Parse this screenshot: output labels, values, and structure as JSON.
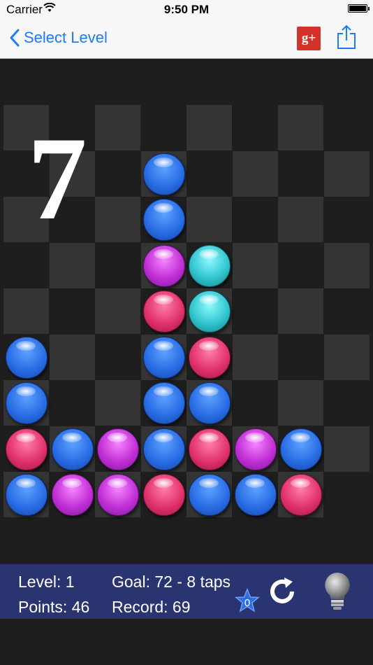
{
  "status": {
    "carrier": "Carrier",
    "time": "9:50 PM"
  },
  "nav": {
    "back_label": "Select Level",
    "gplus_label": "g+"
  },
  "countdown": "7",
  "hud": {
    "level": "Level: 1",
    "goal": "Goal: 72 - 8 taps",
    "points": "Points: 46",
    "record": "Record: 69",
    "stars": "0"
  },
  "colors": {
    "blue": "#2a6ee6",
    "pink": "#e2336d",
    "purple": "#c230d6",
    "cyan": "#32c6cf",
    "hud": "#2a3470",
    "accent": "#1b7cf5"
  },
  "board": {
    "cols": 8,
    "rows": 9,
    "grid": [
      [
        "",
        "",
        "",
        "",
        "",
        "",
        "",
        ""
      ],
      [
        "",
        "",
        "",
        "blue",
        "",
        "",
        "",
        ""
      ],
      [
        "",
        "",
        "",
        "blue",
        "",
        "",
        "",
        ""
      ],
      [
        "",
        "",
        "",
        "purple",
        "cyan",
        "",
        "",
        ""
      ],
      [
        "",
        "",
        "",
        "pink",
        "cyan",
        "",
        "",
        ""
      ],
      [
        "blue",
        "",
        "",
        "blue",
        "pink",
        "",
        "",
        ""
      ],
      [
        "blue",
        "",
        "",
        "blue",
        "blue",
        "",
        "",
        ""
      ],
      [
        "pink",
        "blue",
        "purple",
        "blue",
        "pink",
        "purple",
        "blue",
        ""
      ],
      [
        "blue",
        "purple",
        "purple",
        "pink",
        "blue",
        "blue",
        "pink",
        ""
      ]
    ]
  }
}
